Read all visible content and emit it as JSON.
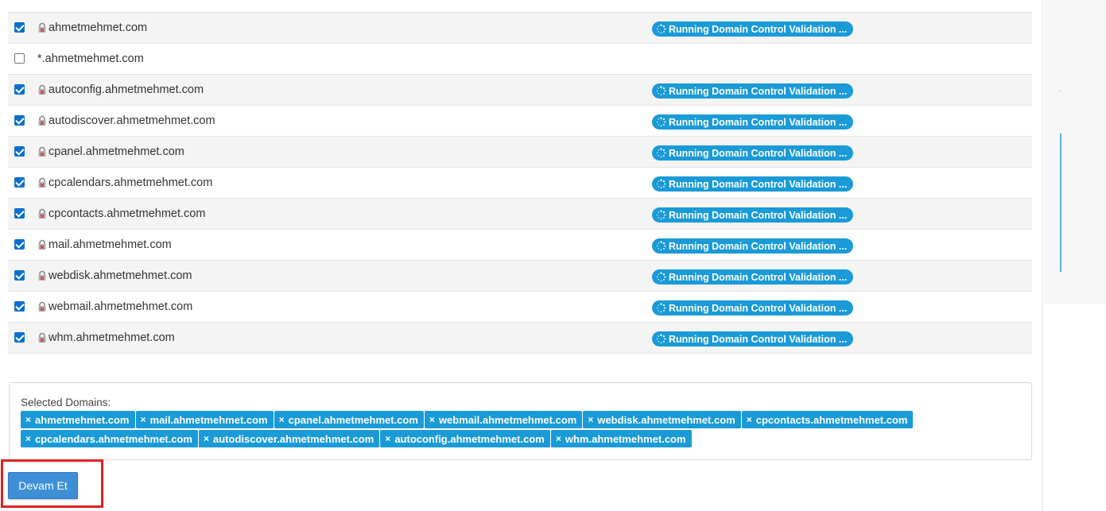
{
  "table": {
    "status_label": "Running Domain Control Validation ...",
    "rows": [
      {
        "domain": "ahmetmehmet.com",
        "checked": true,
        "lock": true
      },
      {
        "domain": "*.ahmetmehmet.com",
        "checked": false,
        "lock": false
      },
      {
        "domain": "autoconfig.ahmetmehmet.com",
        "checked": true,
        "lock": true
      },
      {
        "domain": "autodiscover.ahmetmehmet.com",
        "checked": true,
        "lock": true
      },
      {
        "domain": "cpanel.ahmetmehmet.com",
        "checked": true,
        "lock": true
      },
      {
        "domain": "cpcalendars.ahmetmehmet.com",
        "checked": true,
        "lock": true
      },
      {
        "domain": "cpcontacts.ahmetmehmet.com",
        "checked": true,
        "lock": true
      },
      {
        "domain": "mail.ahmetmehmet.com",
        "checked": true,
        "lock": true
      },
      {
        "domain": "webdisk.ahmetmehmet.com",
        "checked": true,
        "lock": true
      },
      {
        "domain": "webmail.ahmetmehmet.com",
        "checked": true,
        "lock": true
      },
      {
        "domain": "whm.ahmetmehmet.com",
        "checked": true,
        "lock": true
      }
    ]
  },
  "selected": {
    "label": "Selected Domains:",
    "remove_icon": "×",
    "tags": [
      [
        "ahmetmehmet.com",
        "mail.ahmetmehmet.com",
        "cpanel.ahmetmehmet.com",
        "webmail.ahmetmehmet.com",
        "webdisk.ahmetmehmet.com",
        "cpcontacts.ahmetmehmet.com"
      ],
      [
        "cpcalendars.ahmetmehmet.com",
        "autodiscover.ahmetmehmet.com",
        "autoconfig.ahmetmehmet.com",
        "whm.ahmetmehmet.com"
      ]
    ]
  },
  "actions": {
    "continue_label": "Devam Et"
  },
  "colors": {
    "badge": "#1a9ad7",
    "button": "#3f8fd6",
    "highlight": "#e02020"
  },
  "icons": {
    "lock": "lock-icon",
    "status": "spinner-icon",
    "remove": "remove-icon"
  }
}
